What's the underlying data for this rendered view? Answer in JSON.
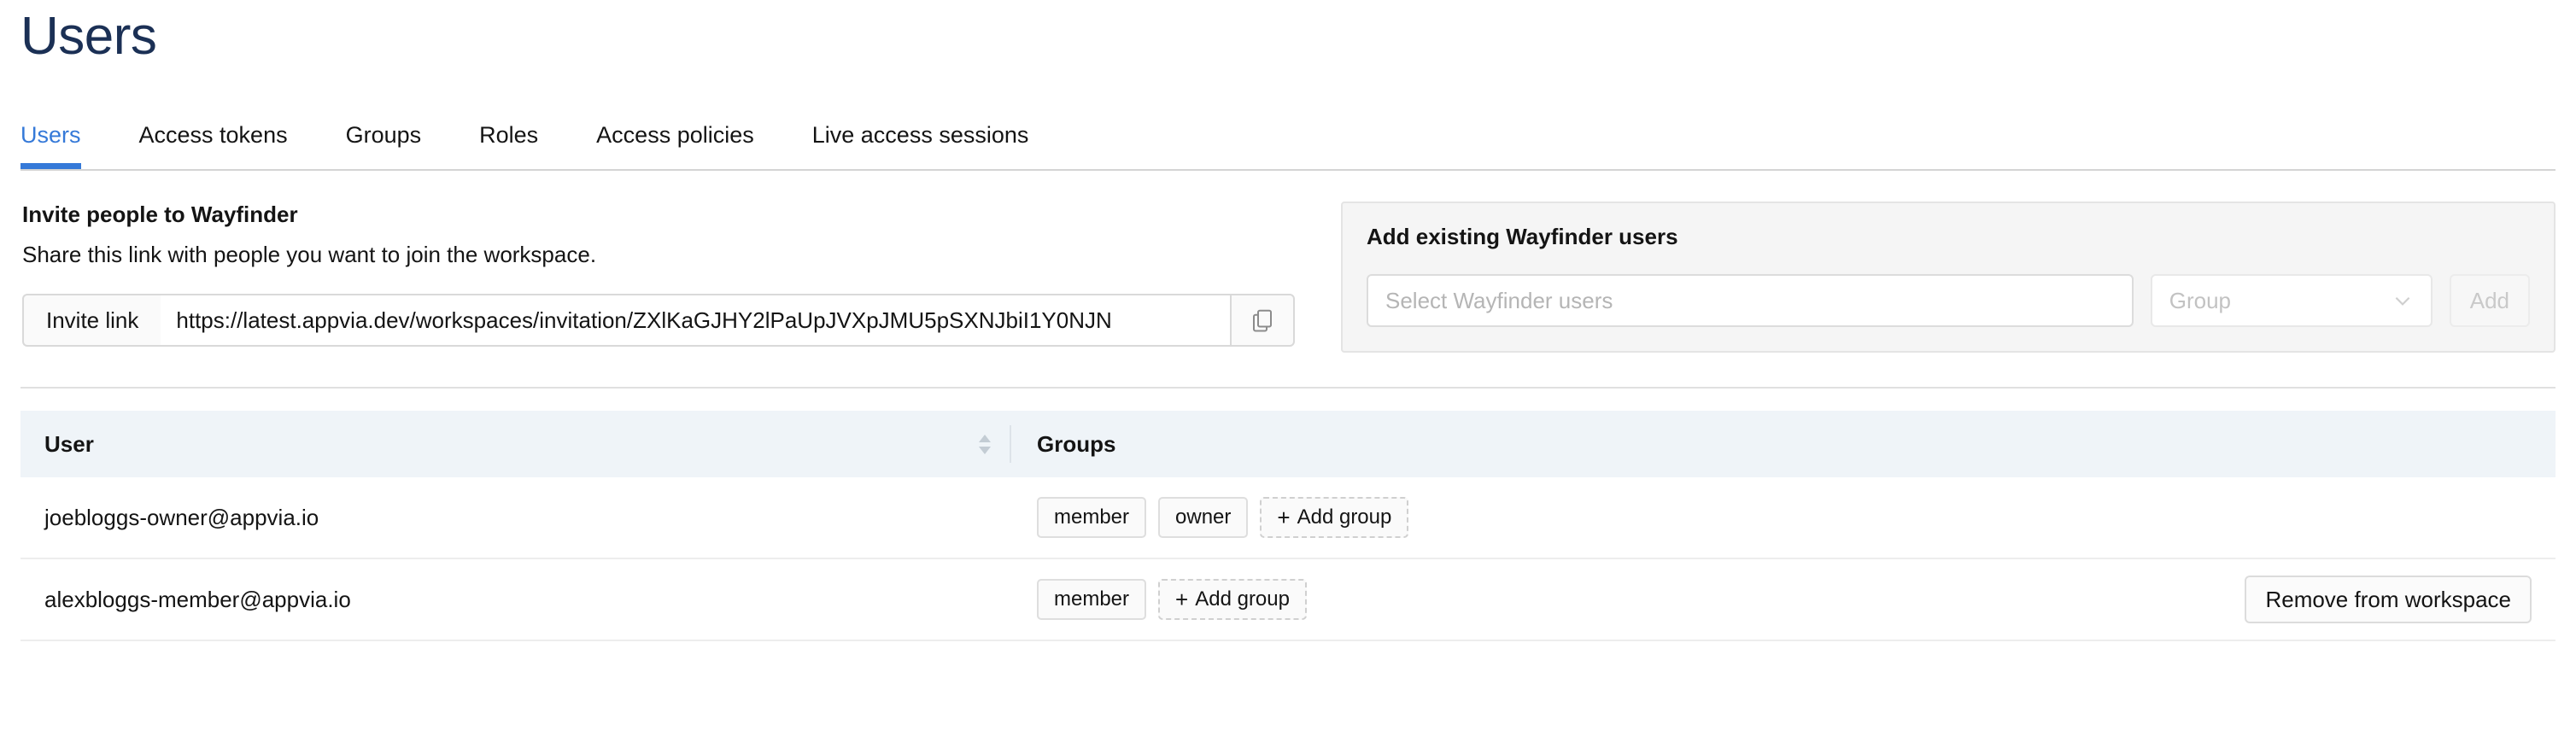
{
  "page": {
    "title": "Users"
  },
  "tabs": [
    {
      "label": "Users",
      "active": true
    },
    {
      "label": "Access tokens",
      "active": false
    },
    {
      "label": "Groups",
      "active": false
    },
    {
      "label": "Roles",
      "active": false
    },
    {
      "label": "Access policies",
      "active": false
    },
    {
      "label": "Live access sessions",
      "active": false
    }
  ],
  "invite": {
    "title": "Invite people to Wayfinder",
    "subtitle": "Share this link with people you want to join the workspace.",
    "addon_label": "Invite link",
    "url": "https://latest.appvia.dev/workspaces/invitation/ZXlKaGJHY2lPaUpJVXpJMU5pSXNJbiI1Y0NJN",
    "copy_icon": "copy-icon"
  },
  "add_existing": {
    "title": "Add existing Wayfinder users",
    "users_placeholder": "Select Wayfinder users",
    "group_placeholder": "Group",
    "group_chevron_icon": "chevron-down-icon",
    "add_label": "Add"
  },
  "table": {
    "columns": {
      "user": "User",
      "groups": "Groups"
    },
    "sort_icon": "sort-arrows-icon",
    "add_group_label": "Add group",
    "remove_label": "Remove from workspace",
    "rows": [
      {
        "email": "joebloggs-owner@appvia.io",
        "groups": [
          "member",
          "owner"
        ],
        "has_remove": false
      },
      {
        "email": "alexbloggs-member@appvia.io",
        "groups": [
          "member"
        ],
        "has_remove": true
      }
    ]
  },
  "colors": {
    "title": "#1b3055",
    "accent": "#3579d8",
    "table_header_bg": "#eff4f8",
    "panel_bg": "#f5f5f5"
  }
}
